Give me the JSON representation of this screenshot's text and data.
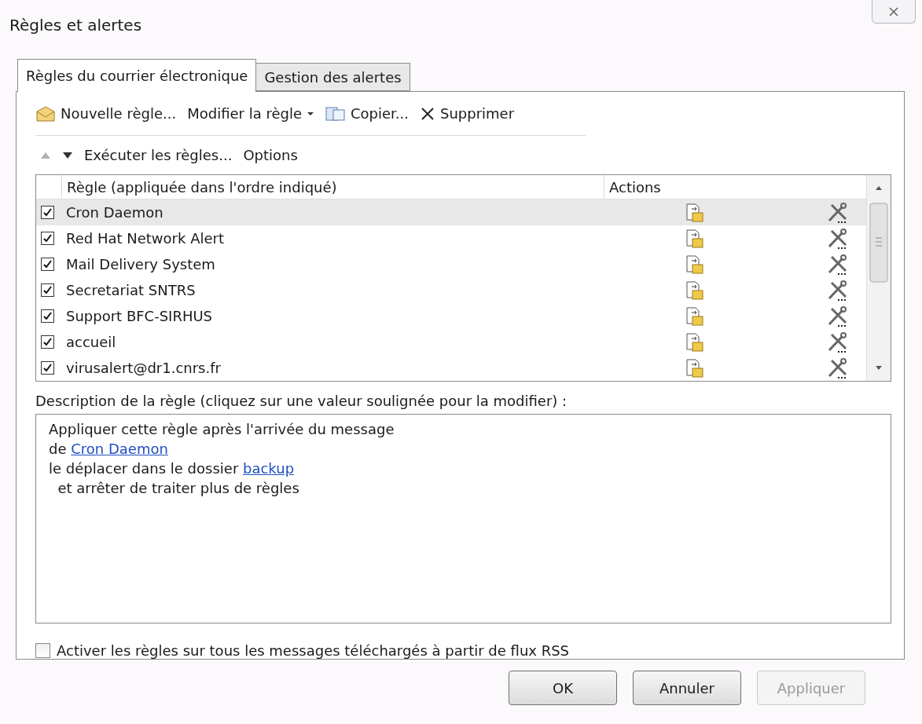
{
  "window": {
    "title": "Règles et alertes"
  },
  "tabs": [
    {
      "label": "Règles du courrier électronique",
      "selected": true
    },
    {
      "label": "Gestion des alertes",
      "selected": false
    }
  ],
  "toolbar": [
    {
      "kind": "new",
      "label": "Nouvelle règle..."
    },
    {
      "kind": "dropdown",
      "label": "Modifier la règle"
    },
    {
      "kind": "copy",
      "label": "Copier..."
    },
    {
      "kind": "delete",
      "label": "Supprimer"
    }
  ],
  "toolbar2": {
    "up_disabled": true,
    "down_disabled": false,
    "run": "Exécuter les règles...",
    "options": "Options"
  },
  "table": {
    "columns": [
      "Règle (appliquée dans l'ordre indiqué)",
      "Actions"
    ],
    "rows": [
      {
        "name": "Cron Daemon",
        "checked": true,
        "selected": true
      },
      {
        "name": "Red Hat Network Alert",
        "checked": true,
        "selected": false
      },
      {
        "name": "Mail Delivery System",
        "checked": true,
        "selected": false
      },
      {
        "name": "Secretariat SNTRS",
        "checked": true,
        "selected": false
      },
      {
        "name": "Support BFC-SIRHUS",
        "checked": true,
        "selected": false
      },
      {
        "name": "accueil",
        "checked": true,
        "selected": false
      },
      {
        "name": "virusalert@dr1.cnrs.fr",
        "checked": true,
        "selected": false
      }
    ]
  },
  "description": {
    "label": "Description de la règle (cliquez sur une valeur soulignée pour la modifier) :",
    "lines": [
      {
        "text": "Appliquer cette règle après l'arrivée du message"
      },
      {
        "text": "de ",
        "link": "Cron Daemon"
      },
      {
        "text": "le déplacer dans le dossier ",
        "link": "backup"
      },
      {
        "text": "  et arrêter de traiter plus de règles"
      }
    ]
  },
  "rss": {
    "label": "Activer les règles sur tous les messages téléchargés à partir de flux RSS",
    "checked": false
  },
  "buttons": [
    {
      "label": "OK",
      "disabled": false
    },
    {
      "label": "Annuler",
      "disabled": false
    },
    {
      "label": "Appliquer",
      "disabled": true
    }
  ]
}
